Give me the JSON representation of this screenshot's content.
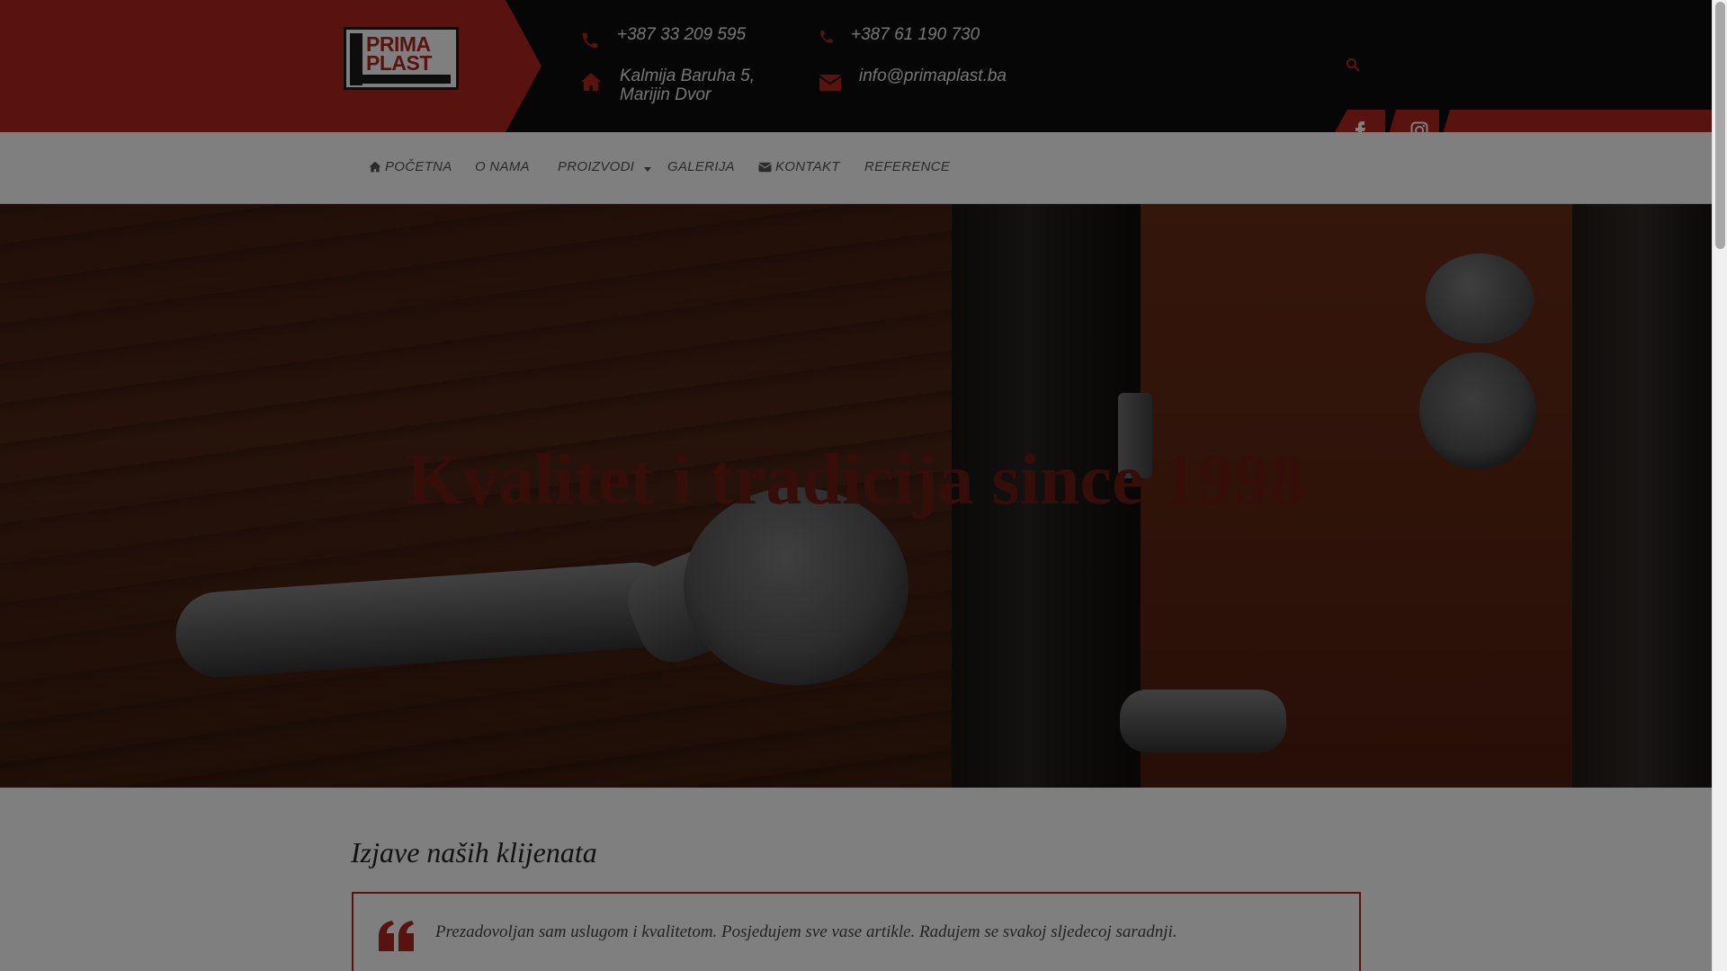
{
  "header": {
    "logo": {
      "line1": "PRIMA",
      "line2": "PLAST"
    },
    "phone1": "+387 33 209 595",
    "phone2": "+387 61 190 730",
    "address": "Kalmija Baruha 5, Marijin Dvor",
    "email": "info@primaplast.ba"
  },
  "icons": {
    "phone": "phone-icon",
    "home": "home-icon",
    "mail": "envelope-icon",
    "search": "search-icon",
    "facebook": "facebook-icon",
    "instagram": "instagram-icon",
    "quote": "quote-icon"
  },
  "nav": {
    "items": [
      {
        "label": "Početna"
      },
      {
        "label": "O nama"
      },
      {
        "label": "Proizvodi"
      },
      {
        "label": "Galerija"
      },
      {
        "label": "Kontakt"
      },
      {
        "label": "Reference"
      }
    ]
  },
  "hero": {
    "title": "Kvalitet i tradicija since 1998"
  },
  "testimonials": {
    "title": "Izjave naših klijenata",
    "items": [
      {
        "text": "Prezadovoljan sam uslugom i kvalitetom. Posjedujem sve vase artikle. Radujem se svakoj sljedecoj saradnji."
      }
    ]
  },
  "colors": {
    "brand_red": "#b3261e",
    "header_dark": "#0d0d0d",
    "overlay": "rgba(0,0,0,0.5)"
  }
}
